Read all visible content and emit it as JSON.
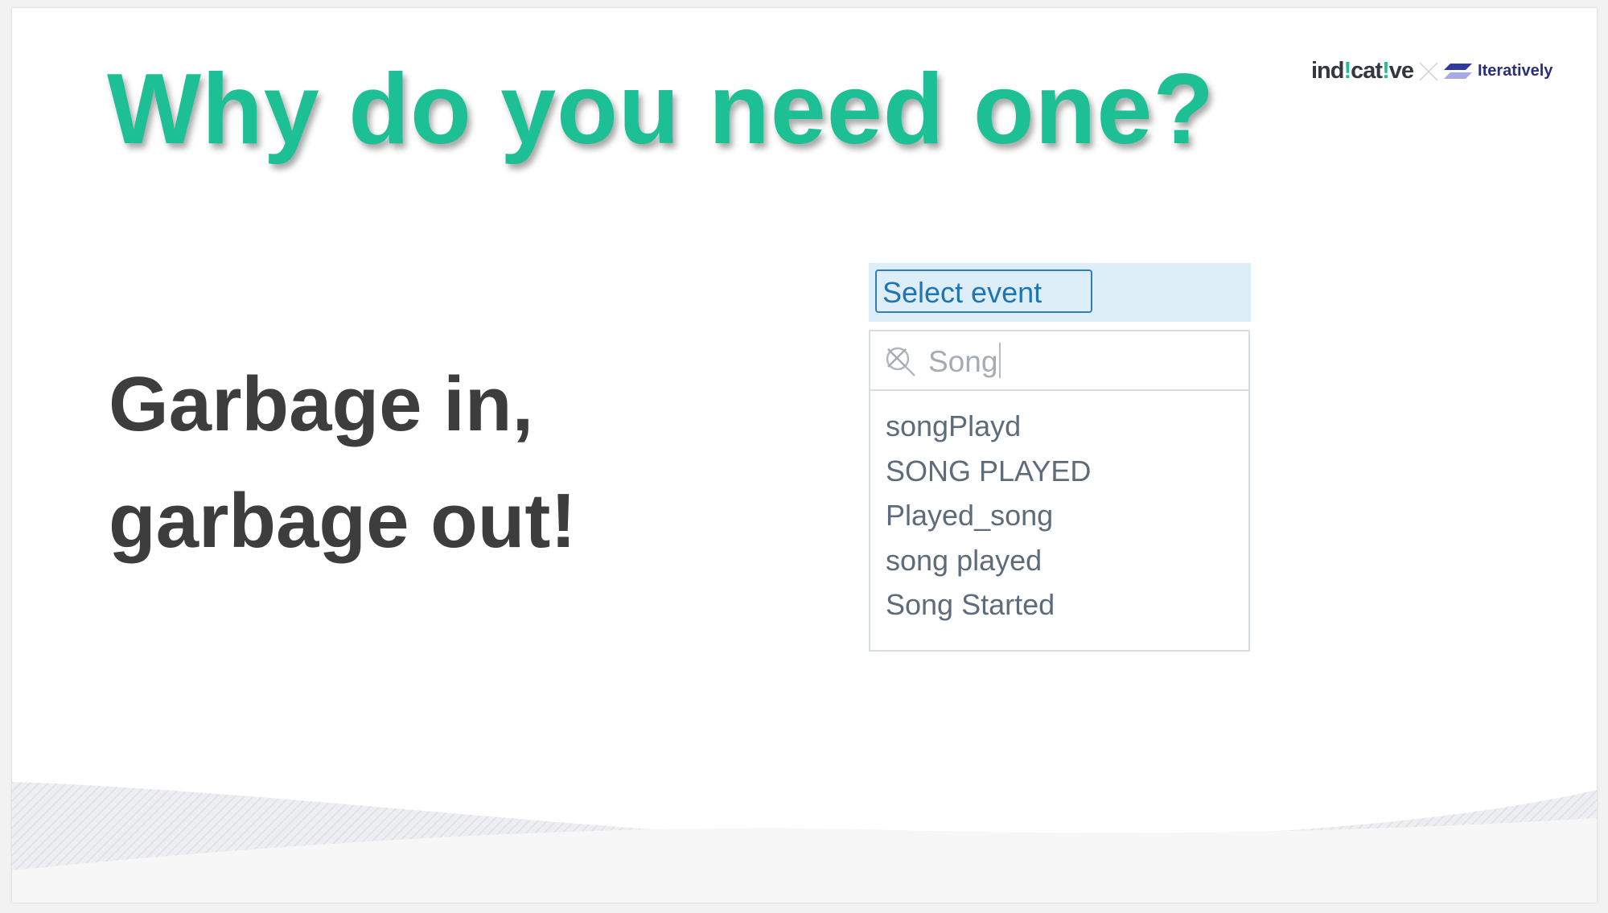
{
  "slide": {
    "title": "Why do you need one?",
    "tagline_line1": "Garbage in,",
    "tagline_line2": "garbage out!"
  },
  "logo": {
    "brand1": "indicative",
    "separator": "×",
    "brand2": "Iteratively"
  },
  "widget": {
    "select_label": "Select event",
    "search_value": "Song",
    "search_icon": "search-icon",
    "clear_icon": "close-icon",
    "results": [
      "songPlayd",
      "SONG PLAYED",
      "Played_song",
      "song played",
      "Song Started"
    ]
  },
  "colors": {
    "accent": "#1dbf94",
    "select_blue": "#1f74b4",
    "select_bg": "#ddeef9"
  }
}
